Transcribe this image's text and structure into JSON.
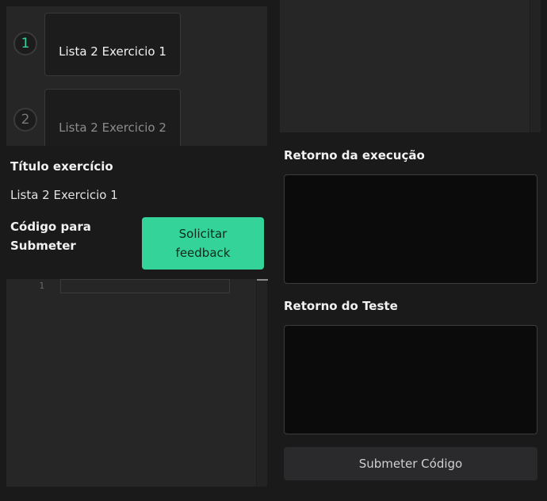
{
  "exercises": [
    {
      "number": "1",
      "title": "Lista 2 Exercicio 1"
    },
    {
      "number": "2",
      "title": "Lista 2 Exercicio 2"
    }
  ],
  "info": {
    "title_label": "Título exercício",
    "title_value": "Lista 2 Exercicio 1",
    "code_label_line1": "Código para",
    "code_label_line2": "Submeter",
    "feedback_line1": "Solicitar",
    "feedback_line2": "feedback"
  },
  "editor": {
    "line_numbers": [
      "1"
    ]
  },
  "output": {
    "execution_label": "Retorno da execução",
    "test_label": "Retorno do Teste",
    "submit_label": "Submeter Código"
  },
  "colors": {
    "accent": "#34d399",
    "background": "#1a1a1b",
    "panel": "#262626",
    "output_box": "#0b0b0c"
  }
}
